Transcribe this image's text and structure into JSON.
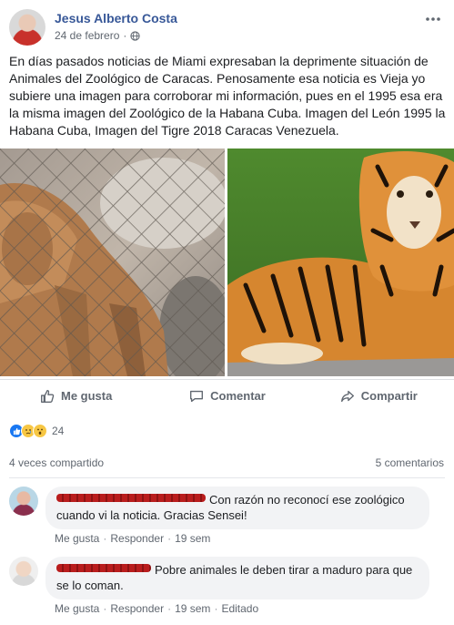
{
  "post": {
    "author": "Jesus Alberto Costa",
    "date": "24 de febrero",
    "separator": "·",
    "privacy_icon": "globe-icon",
    "more_icon": "more-horizontal-icon",
    "text": "En días pasados noticias de Miami expresaban la deprimente situación de Animales del Zoológico de Caracas. Penosamente esa noticia es Vieja yo subiere una imagen para corroborar mi información, pues en el 1995 esa era la misma imagen del Zoológico de la Habana Cuba. Imagen del León 1995 la Habana Cuba, Imagen del Tigre 2018 Caracas Venezuela."
  },
  "actions": {
    "like_label": "Me gusta",
    "comment_label": "Comentar",
    "share_label": "Compartir"
  },
  "reactions": {
    "types": [
      "like",
      "sad",
      "wow"
    ],
    "count": "24"
  },
  "stats": {
    "shares": "4 veces compartido",
    "comments": "5 comentarios"
  },
  "comments": [
    {
      "text": "Con razón no reconocí ese zoológico cuando vi la noticia. Gracias Sensei!",
      "actions": [
        "Me gusta",
        "Responder",
        "19 sem"
      ]
    },
    {
      "text": "Pobre animales le deben tirar a maduro para que se lo coman.",
      "actions": [
        "Me gusta",
        "Responder",
        "19 sem",
        "Editado"
      ]
    }
  ],
  "colors": {
    "author_link": "#385898",
    "secondary_text": "#606770",
    "comment_bubble": "#f2f3f5",
    "like_blue": "#1877f2",
    "redaction_red": "#b91d1d"
  }
}
